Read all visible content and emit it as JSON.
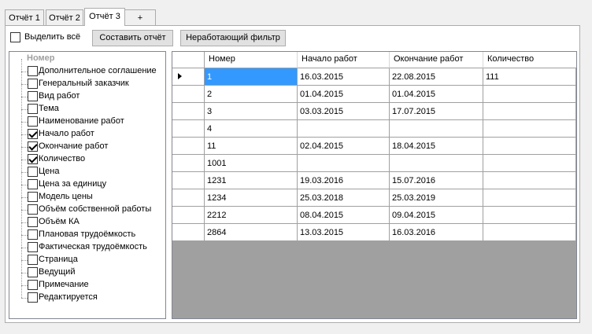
{
  "tabs": [
    {
      "label": "Отчёт 1"
    },
    {
      "label": "Отчёт 2"
    },
    {
      "label": "Отчёт 3"
    },
    {
      "label": "+"
    }
  ],
  "toolbar": {
    "select_all_label": "Выделить всё",
    "make_report_label": "Составить отчёт",
    "broken_filter_label": "Неработающий фильтр"
  },
  "tree": {
    "root": "Номер",
    "items": [
      {
        "label": "Дополнительное соглашение",
        "checked": false
      },
      {
        "label": "Генеральный заказчик",
        "checked": false
      },
      {
        "label": "Вид работ",
        "checked": false
      },
      {
        "label": "Тема",
        "checked": false
      },
      {
        "label": "Наименование работ",
        "checked": false
      },
      {
        "label": "Начало работ",
        "checked": true
      },
      {
        "label": "Окончание работ",
        "checked": true
      },
      {
        "label": "Количество",
        "checked": true
      },
      {
        "label": "Цена",
        "checked": false
      },
      {
        "label": "Цена за единицу",
        "checked": false
      },
      {
        "label": "Модель цены",
        "checked": false
      },
      {
        "label": "Объём собственной работы",
        "checked": false
      },
      {
        "label": "Объём КА",
        "checked": false
      },
      {
        "label": "Плановая трудоёмкость",
        "checked": false
      },
      {
        "label": "Фактическая трудоёмкость",
        "checked": false
      },
      {
        "label": "Страница",
        "checked": false
      },
      {
        "label": "Ведущий",
        "checked": false
      },
      {
        "label": "Примечание",
        "checked": false
      },
      {
        "label": "Редактируется",
        "checked": false
      }
    ]
  },
  "grid": {
    "columns": [
      "Номер",
      "Начало работ",
      "Окончание работ",
      "Количество"
    ],
    "rows": [
      [
        "1",
        "16.03.2015",
        "22.08.2015",
        "111"
      ],
      [
        "2",
        "01.04.2015",
        "01.04.2015",
        ""
      ],
      [
        "3",
        "03.03.2015",
        "17.07.2015",
        ""
      ],
      [
        "4",
        "",
        "",
        ""
      ],
      [
        "11",
        "02.04.2015",
        "18.04.2015",
        ""
      ],
      [
        "1001",
        "",
        "",
        ""
      ],
      [
        "1231",
        "19.03.2016",
        "15.07.2016",
        ""
      ],
      [
        "1234",
        "25.03.2018",
        "25.03.2019",
        ""
      ],
      [
        "2212",
        "08.04.2015",
        "09.04.2015",
        ""
      ],
      [
        "2864",
        "13.03.2015",
        "16.03.2016",
        ""
      ]
    ]
  }
}
